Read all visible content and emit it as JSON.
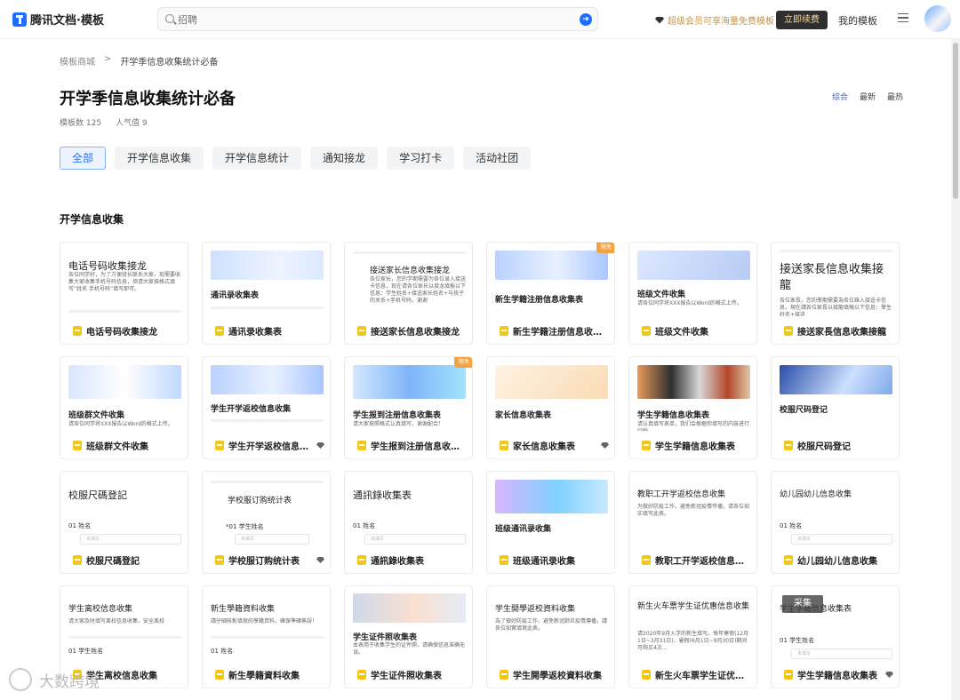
{
  "app": {
    "logo": "腾讯文档·模板"
  },
  "search": {
    "placeholder": "招聘"
  },
  "header": {
    "vip_promo": "超级会员可享海量免费模板",
    "renew_button": "立即续费",
    "my_templates": "我的模板"
  },
  "breadcrumb": {
    "root": "模板商城",
    "separator": ">",
    "current": "开学季信息收集统计必备"
  },
  "page": {
    "title": "开学季信息收集统计必备",
    "template_count": "模板数 125",
    "popularity": "人气值 9"
  },
  "sort": [
    "综合",
    "最新",
    "最热"
  ],
  "tabs": [
    "全部",
    "开学信息收集",
    "开学信息统计",
    "通知接龙",
    "学习打卡",
    "活动社团"
  ],
  "section": {
    "title": "开学信息收集"
  },
  "badge_text": "限免",
  "float_button": "采集",
  "watermark": "大数跨境",
  "cards": [
    {
      "name": "电话号码收集接龙",
      "preview_title": "电话号码收集接龙",
      "preview_text": "各位同学好，为了方便班长联系大家，现需要收集大家收集手机号码信息，烦请大家按格式填写“姓名 手机号码”填写即可。"
    },
    {
      "name": "通讯录收集表",
      "preview_title": "通讯录收集表"
    },
    {
      "name": "接送家长信息收集接龙",
      "preview_title": "接送家长信息收集接龙",
      "preview_text": "各位家长，您的学期需要为各位录入接送卡信息，现在请各位家长以接龙填报以下信息：学生姓名+接送家长姓名+与孩子的关系+手机号码，谢谢"
    },
    {
      "name": "新生学籍注册信息收集表",
      "preview_title": "新生学籍注册信息收集表",
      "badge": true
    },
    {
      "name": "班级文件收集",
      "preview_title": "班级文件收集",
      "preview_text": "请各位同学将XXX报告以Word的格式上传。"
    },
    {
      "name": "接送家長信息收集接龍",
      "preview_title": "接送家長信息收集接龍",
      "preview_text": "各位家長，您的學期需要為各位錄入接送卡信息，現在請各位家長以接龍填報以下信息：學生姓名+接送"
    },
    {
      "name": "班级群文件收集",
      "preview_title": "班级群文件收集",
      "preview_text": "请各位同学将XXX报告以Word的格式上传。"
    },
    {
      "name": "学生开学返校信息收集",
      "preview_title": "学生开学返校信息收集",
      "diamond": true
    },
    {
      "name": "学生报到注册信息收集表",
      "preview_title": "学生报到注册信息收集表",
      "preview_text": "请大家按照格式认真填写，谢谢配合！",
      "badge": true
    },
    {
      "name": "家长信息收集表",
      "preview_title": "家长信息收集表",
      "diamond": true
    },
    {
      "name": "学生学籍信息收集表",
      "preview_title": "学生学籍信息收集表",
      "preview_text": "请认真填写表单，我们会根据你填写的内容进行归档"
    },
    {
      "name": "校服尺码登记",
      "preview_title": "校服尺码登记"
    },
    {
      "name": "校服尺碼登記",
      "preview_title": "校服尺碼登記",
      "field": "01 姓名",
      "input_hint": "未填写"
    },
    {
      "name": "学校服订购统计表",
      "preview_title": "学校服订购统计表",
      "field": "*01 学生姓名",
      "input_hint": "未填写",
      "diamond": true
    },
    {
      "name": "通訊錄收集表",
      "preview_title": "通訊錄收集表",
      "field": "01 姓名",
      "input_hint": "未填写"
    },
    {
      "name": "班级通讯录收集",
      "preview_title": "班级通讯录收集"
    },
    {
      "name": "教职工开学返校信息收集",
      "preview_title": "教职工开学返校信息收集",
      "preview_text": "为做好防疫工作，避免新冠疫情传播，请各位如实填写此表。"
    },
    {
      "name": "幼儿园幼儿信息收集",
      "preview_title": "幼儿园幼儿信息收集",
      "field": "01 姓名",
      "input_hint": "未填写"
    },
    {
      "name": "学生离校信息收集",
      "preview_title": "学生离校信息收集",
      "preview_text": "请大家及时填写离校信息收集，安全离校",
      "field": "01 学生姓名"
    },
    {
      "name": "新生學籍資料收集",
      "preview_title": "新生學籍資料收集",
      "preview_text": "請仔細核對填寫的學籍資料，確保準確無誤！",
      "field": "01 姓名"
    },
    {
      "name": "学生证件照收集表",
      "preview_title": "学生证件照收集表",
      "preview_text": "本表用于收集学生的证件照，请确保信息准确无误。"
    },
    {
      "name": "学生開學返校資料收集",
      "preview_title": "学生開學返校資料收集",
      "preview_text": "為了做好防疫工作，避免新冠肺炎疫情傳播，請各位如實填寫此表。"
    },
    {
      "name": "新生火车票学生证优惠信息收集",
      "preview_title": "新生火车票学生证优惠信息收集",
      "preview_text": "请2020年9月入学的新生填写。每年寒假(12月1日~3月31日)、暑假(6月1日~9月30日)期间可购买4次...",
      "float_label": "采集"
    },
    {
      "name": "学生学籍信息收集表",
      "preview_title": "学生学籍信息收集表",
      "field": "01 学生姓名",
      "input_hint": "未填写",
      "diamond": true
    }
  ]
}
